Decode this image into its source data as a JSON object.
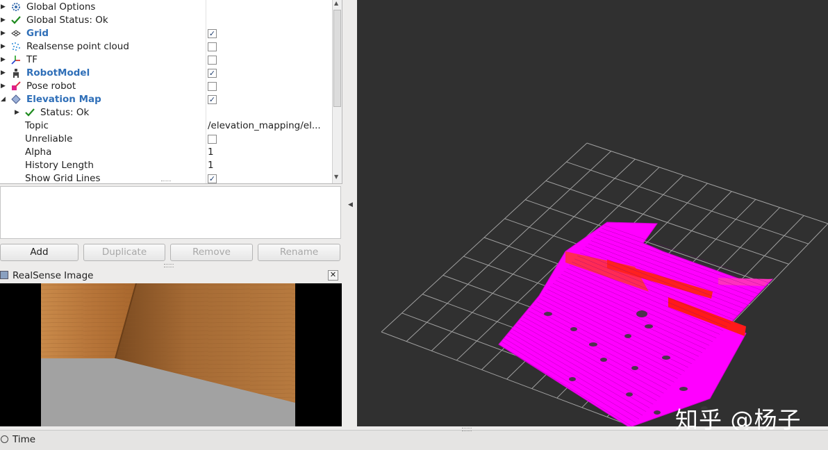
{
  "displays": {
    "rows": [
      {
        "label": "Global Options",
        "strong": false,
        "expand": "collapsed",
        "icon": "gear-icon",
        "indent": 0,
        "checked": null,
        "value": null
      },
      {
        "label": "Global Status: Ok",
        "strong": false,
        "expand": "collapsed",
        "icon": "checkmark-icon",
        "indent": 0,
        "checked": null,
        "value": null
      },
      {
        "label": "Grid",
        "strong": true,
        "expand": "collapsed",
        "icon": "grid-icon",
        "indent": 0,
        "checked": true,
        "value": null
      },
      {
        "label": "Realsense point cloud",
        "strong": false,
        "expand": "collapsed",
        "icon": "point-cloud-icon",
        "indent": 0,
        "checked": false,
        "value": null
      },
      {
        "label": "TF",
        "strong": false,
        "expand": "collapsed",
        "icon": "tf-axes-icon",
        "indent": 0,
        "checked": false,
        "value": null
      },
      {
        "label": "RobotModel",
        "strong": true,
        "expand": "collapsed",
        "icon": "robot-icon",
        "indent": 0,
        "checked": true,
        "value": null
      },
      {
        "label": "Pose robot",
        "strong": false,
        "expand": "collapsed",
        "icon": "pose-arrow-icon",
        "indent": 0,
        "checked": false,
        "value": null
      },
      {
        "label": "Elevation Map",
        "strong": true,
        "expand": "expanded",
        "icon": "elevation-map-icon",
        "indent": 0,
        "checked": true,
        "value": null
      },
      {
        "label": "Status: Ok",
        "strong": false,
        "expand": "collapsed",
        "icon": "checkmark-icon",
        "indent": 1,
        "checked": null,
        "value": null
      },
      {
        "label": "Topic",
        "strong": false,
        "expand": "none",
        "icon": null,
        "indent": 1,
        "checked": null,
        "value": "/elevation_mapping/el..."
      },
      {
        "label": "Unreliable",
        "strong": false,
        "expand": "none",
        "icon": null,
        "indent": 1,
        "checked": false,
        "value": null
      },
      {
        "label": "Alpha",
        "strong": false,
        "expand": "none",
        "icon": null,
        "indent": 1,
        "checked": null,
        "value": "1"
      },
      {
        "label": "History Length",
        "strong": false,
        "expand": "none",
        "icon": null,
        "indent": 1,
        "checked": null,
        "value": "1"
      },
      {
        "label": "Show Grid Lines",
        "strong": false,
        "expand": "none",
        "icon": null,
        "indent": 1,
        "checked": true,
        "value": null
      }
    ]
  },
  "buttons": {
    "add": "Add",
    "duplicate": "Duplicate",
    "remove": "Remove",
    "rename": "Rename"
  },
  "image_panel": {
    "title": "RealSense Image",
    "close_glyph": "✕"
  },
  "time_panel": {
    "title": "Time"
  },
  "watermark": "知乎 @杨子",
  "colors": {
    "elevation_map": "#ff00ff",
    "elevation_edge": "#ff1a1a",
    "grid_lines": "#a0a0a0",
    "view_background": "#303030",
    "highlight_label": "#2f6fb8"
  }
}
